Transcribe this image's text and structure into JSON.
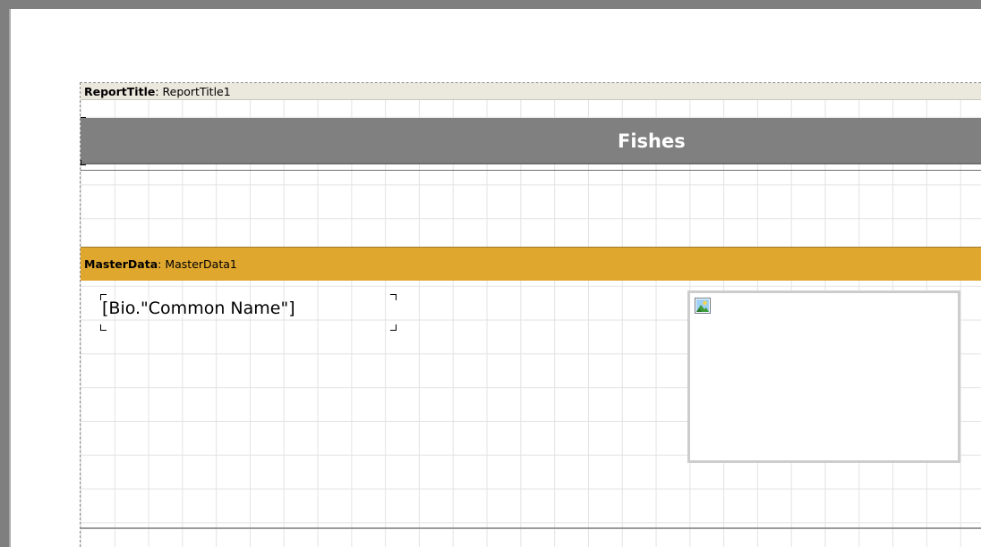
{
  "report_title_band": {
    "type_label": "ReportTitle",
    "separator": ": ",
    "name": "ReportTitle1"
  },
  "title_text": "Fishes",
  "master_data_band": {
    "type_label": "MasterData",
    "separator": ": ",
    "name": "MasterData1"
  },
  "field_expression": "[Bio.\"Common Name\"]",
  "picture_placeholder": {
    "icon": "image-icon"
  },
  "colors": {
    "report_title_header": "#ebe8dd",
    "title_bar": "#808080",
    "master_data_header": "#e0a72e",
    "frame": "#7f7f7f"
  }
}
